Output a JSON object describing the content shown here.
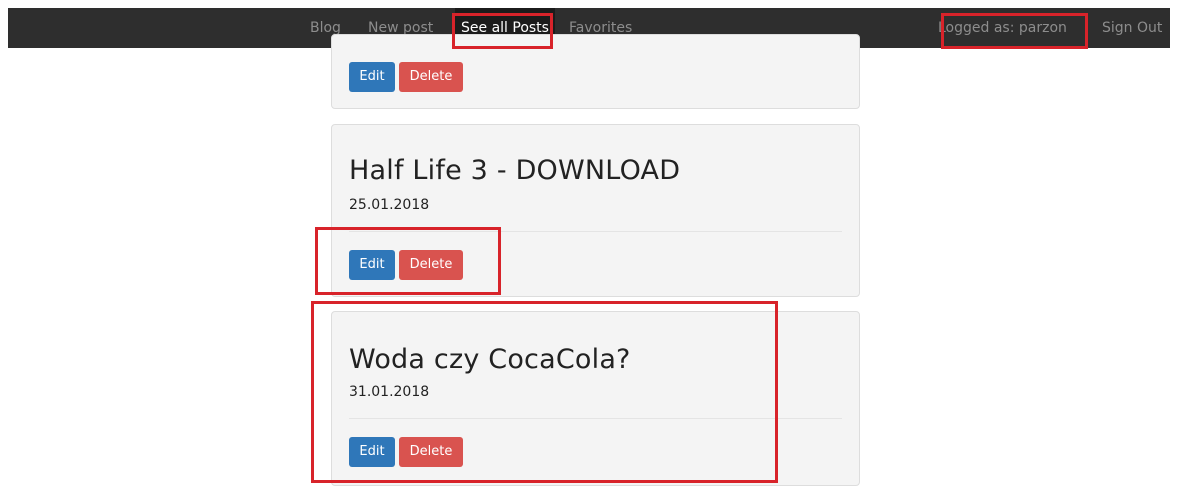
{
  "navbar": {
    "items": [
      {
        "label": "Blog"
      },
      {
        "label": "New post"
      },
      {
        "label": "See all Posts"
      },
      {
        "label": "Favorites"
      }
    ],
    "logged_as": "Logged as: parzon",
    "sign_out": "Sign Out"
  },
  "posts": [
    {
      "title": "",
      "date": "",
      "edit_label": "Edit",
      "delete_label": "Delete"
    },
    {
      "title": "Half Life 3 - DOWNLOAD",
      "date": "25.01.2018",
      "edit_label": "Edit",
      "delete_label": "Delete"
    },
    {
      "title": "Woda czy CocaCola?",
      "date": "31.01.2018",
      "edit_label": "Edit",
      "delete_label": "Delete"
    }
  ],
  "colors": {
    "navbar_bg": "#2e2e2e",
    "edit_button": "#2f77b9",
    "delete_button": "#d9534f",
    "highlight_box": "#d8232a"
  }
}
